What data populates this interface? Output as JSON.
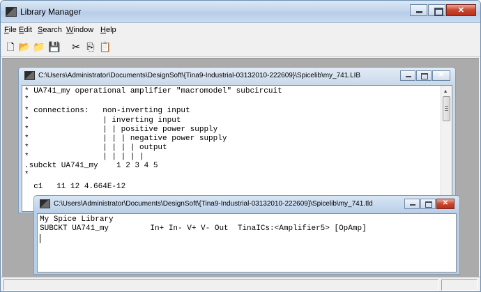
{
  "app": {
    "title": "Library Manager"
  },
  "menu": [
    "File",
    "Edit",
    "Search",
    "Window",
    "Help"
  ],
  "toolbar": [
    {
      "name": "new-icon",
      "glyph": "🗋"
    },
    {
      "name": "open-folder-icon",
      "glyph": "📂"
    },
    {
      "name": "open-library-icon",
      "glyph": "📁"
    },
    {
      "name": "save-icon",
      "glyph": "💾"
    },
    {
      "name": "cut-icon",
      "glyph": "✂"
    },
    {
      "name": "copy-icon",
      "glyph": "⎘"
    },
    {
      "name": "paste-icon",
      "glyph": "📋"
    }
  ],
  "lib_window": {
    "title": "C:\\Users\\Administrator\\Documents\\DesignSoft\\{Tina9-Industrial-03132010-222609}\\Spicelib\\my_741.LIB",
    "lines": [
      "* UA741_my operational amplifier \"macromodel\" subcircuit",
      "*",
      "* connections:   non-inverting input",
      "*                | inverting input",
      "*                | | positive power supply",
      "*                | | | negative power supply",
      "*                | | | | output",
      "*                | | | | |",
      ".subckt UA741_my    1 2 3 4 5",
      "*",
      "  c1   11 12 4.664E-12"
    ]
  },
  "tld_window": {
    "title": "C:\\Users\\Administrator\\Documents\\DesignSoft\\{Tina9-Industrial-03132010-222609}\\Spicelib\\my_741.tld",
    "lines": [
      "My Spice Library",
      "SUBCKT UA741_my         In+ In- V+ V- Out  TinaICs:<Amplifier5> [OpAmp]"
    ]
  }
}
